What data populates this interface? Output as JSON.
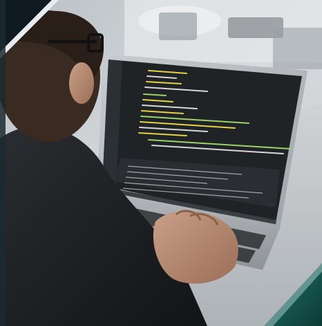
{
  "photo": {
    "subject": "person-coding-on-laptop",
    "palette": {
      "background_light": "#d9dcdf",
      "background_mid": "#a9b0b6",
      "desk": "#c8ccd0",
      "laptop_body": "#b9bdc1",
      "screen_dark": "#1f2326",
      "code_yellow": "#e4d24b",
      "code_green": "#9ad36a",
      "code_white": "#d8d8d8",
      "skin": "#b88a70",
      "shirt": "#1c1f22",
      "hair": "#2a1f18",
      "corner_teal": "#1e5e58",
      "corner_teal_dark": "#0f3e3a"
    }
  },
  "laptop": {
    "screen": {
      "file_tabs": [],
      "code_lines": []
    }
  }
}
